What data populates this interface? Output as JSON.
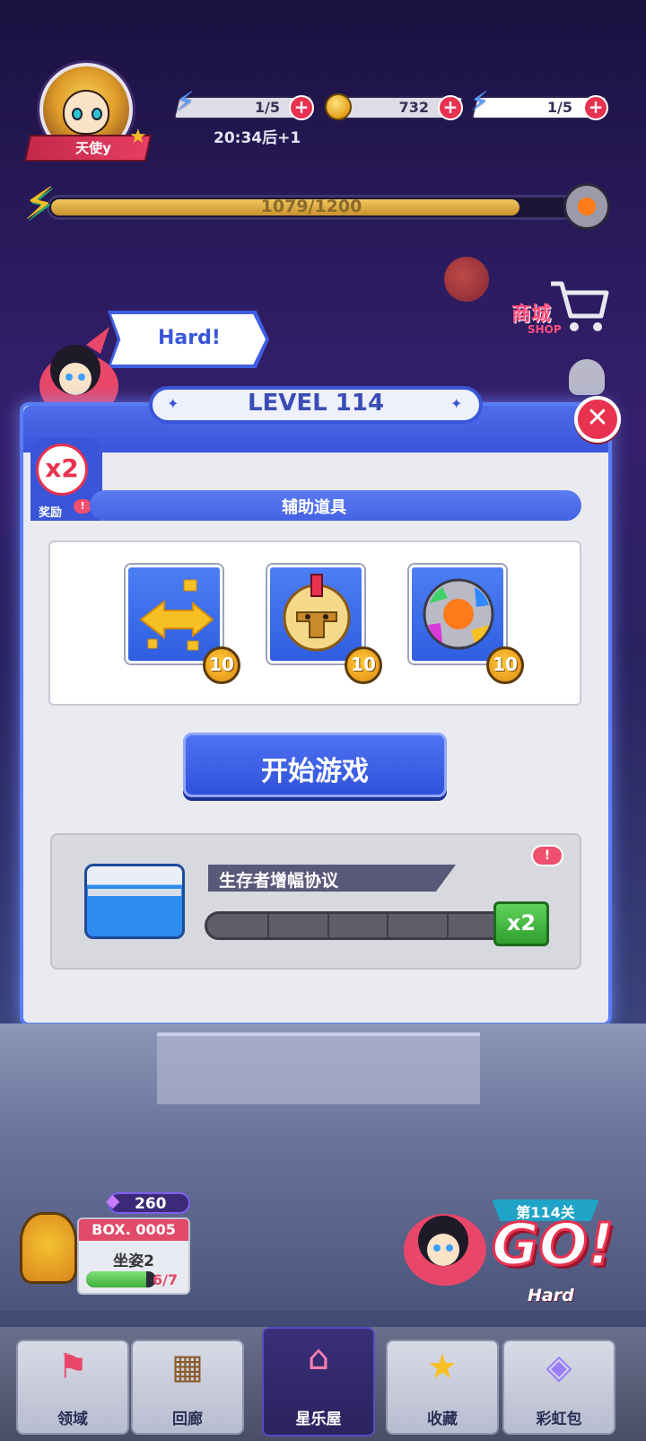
{
  "player": {
    "name": "天使y"
  },
  "resources": {
    "energy": {
      "value": "1/5",
      "icon": "lightning-bolt-icon"
    },
    "coins": {
      "value": "732",
      "icon": "coin-icon"
    },
    "energy_bonus": {
      "value": "1/5",
      "icon": "lightning-bolt-icon"
    },
    "timer": "20:34后+1"
  },
  "xp": {
    "text": "1079/1200",
    "current": 1079,
    "max": 1200
  },
  "shop": {
    "label": "商城",
    "sub": "SHOP"
  },
  "difficulty": {
    "label": "Hard!"
  },
  "modal": {
    "level": "LEVEL 114",
    "close_icon": "close-icon",
    "reward": {
      "multiplier": "x2",
      "label": "奖励",
      "badge": "!"
    },
    "aux_title": "辅助道具",
    "items": [
      {
        "name": "swap-arrows",
        "icon": "swap-arrows-icon",
        "count": "10"
      },
      {
        "name": "gladiator-helmet",
        "icon": "helmet-icon",
        "count": "10"
      },
      {
        "name": "color-orb",
        "icon": "color-orb-icon",
        "count": "10"
      }
    ],
    "start_label": "开始游戏",
    "box": {
      "title": "生存者增幅协议",
      "alert": "!",
      "segments": 5,
      "filled_segments": 0,
      "ticket": "x2"
    }
  },
  "bottom": {
    "gems": "260",
    "box_code": "BOX. 0005",
    "box_name": "坐姿2",
    "box_progress_text": "6/7",
    "box_progress": 0.857,
    "go": {
      "stage": "第114关",
      "label": "GO!",
      "difficulty": "Hard"
    }
  },
  "nav": [
    {
      "label": "领域",
      "icon": "domain-icon"
    },
    {
      "label": "回廊",
      "icon": "gallery-icon"
    },
    {
      "label": "星乐屋",
      "icon": "star-house-icon"
    },
    {
      "label": "收藏",
      "icon": "star-icon"
    },
    {
      "label": "彩虹包",
      "icon": "rainbow-pack-icon"
    }
  ],
  "colors": {
    "accent_blue": "#3a55d8",
    "accent_red": "#e8324f",
    "gold": "#f6c024",
    "green": "#3fae3a"
  }
}
